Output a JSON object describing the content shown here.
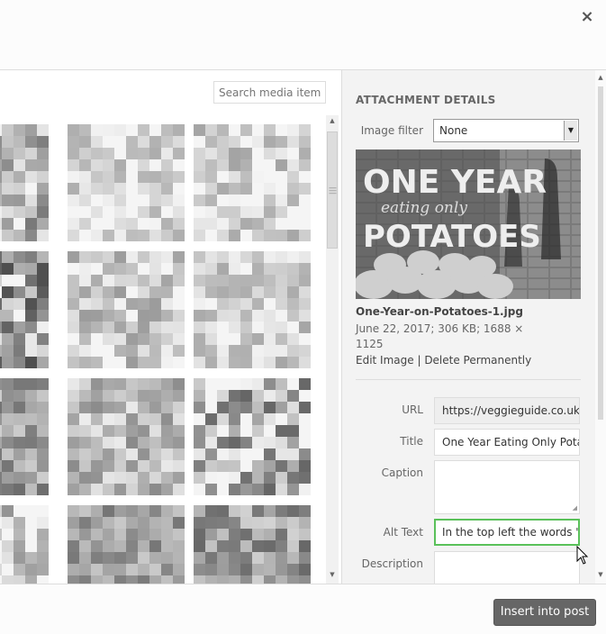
{
  "modal": {
    "close_glyph": "×"
  },
  "browser": {
    "search_placeholder": "Search media items..."
  },
  "details": {
    "heading": "ATTACHMENT DETAILS",
    "filter": {
      "label": "Image filter",
      "value": "None"
    },
    "preview": {
      "title_line1": "ONE YEAR",
      "title_line2": "eating only",
      "title_line3": "POTATOES"
    },
    "filename": "One-Year-on-Potatoes-1.jpg",
    "meta_line1": "June 22, 2017;  306 KB;  1688 ×",
    "meta_line2": "1125",
    "edit_link": "Edit Image",
    "link_sep": " | ",
    "delete_link": "Delete Permanently",
    "fields": {
      "url_label": "URL",
      "url_value": "https://veggieguide.co.uk/",
      "title_label": "Title",
      "title_value": "One Year Eating Only Potat",
      "caption_label": "Caption",
      "caption_value": "",
      "alt_label": "Alt Text",
      "alt_value": "In the top left the words \"O",
      "description_label": "Description",
      "description_value": ""
    }
  },
  "footer": {
    "insert_label": "Insert into post"
  },
  "icons": {
    "close": "close-icon",
    "dropdown": "dropdown-arrow-icon",
    "resize": "resize-handle-icon",
    "cursor": "mouse-pointer-icon"
  }
}
